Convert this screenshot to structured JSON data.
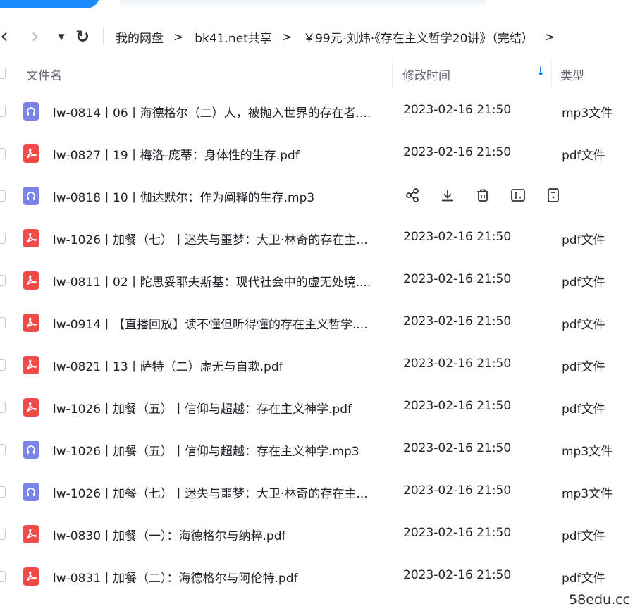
{
  "navigation": {
    "breadcrumb": [
      {
        "label": "我的网盘"
      },
      {
        "label": "bk41.net共享"
      },
      {
        "label": "￥99元-刘炜·《存在主义哲学20讲》（完结）"
      }
    ],
    "separator": ">",
    "tail": ">"
  },
  "table": {
    "columns": {
      "name": "文件名",
      "time": "修改时间",
      "type": "类型"
    },
    "sort": {
      "column": "time",
      "direction": "desc",
      "icon": "↓"
    },
    "rows": [
      {
        "icon": "mp3-audio-icon",
        "name": "lw-0814丨06丨海德格尔（二）人，被抛入世界的存在者....",
        "time": "2023-02-16 21:50",
        "type": "mp3文件"
      },
      {
        "icon": "pdf-icon",
        "name": "lw-0827丨19丨梅洛-庞蒂：身体性的生存.pdf",
        "time": "2023-02-16 21:50",
        "type": "pdf文件"
      },
      {
        "icon": "mp3-audio-icon",
        "name": "lw-0818丨10丨伽达默尔：作为阐释的生存.mp3",
        "hovered": true
      },
      {
        "icon": "pdf-icon",
        "name": "lw-1026丨加餐（七）丨迷失与噩梦：大卫·林奇的存在主...",
        "time": "2023-02-16 21:50",
        "type": "pdf文件"
      },
      {
        "icon": "pdf-icon",
        "name": "lw-0811丨02丨陀思妥耶夫斯基：现代社会中的虚无处境....",
        "time": "2023-02-16 21:50",
        "type": "pdf文件"
      },
      {
        "icon": "pdf-icon",
        "name": "lw-0914丨【直播回放】读不懂但听得懂的存在主义哲学....",
        "time": "2023-02-16 21:50",
        "type": "pdf文件"
      },
      {
        "icon": "pdf-icon",
        "name": "lw-0821丨13丨萨特（二）虚无与自欺.pdf",
        "time": "2023-02-16 21:50",
        "type": "pdf文件"
      },
      {
        "icon": "pdf-icon",
        "name": "lw-1026丨加餐（五）丨信仰与超越：存在主义神学.pdf",
        "time": "2023-02-16 21:50",
        "type": "pdf文件"
      },
      {
        "icon": "mp3-audio-icon",
        "name": "lw-1026丨加餐（五）丨信仰与超越：存在主义神学.mp3",
        "time": "2023-02-16 21:50",
        "type": "mp3文件"
      },
      {
        "icon": "mp3-audio-icon",
        "name": "lw-1026丨加餐（七）丨迷失与噩梦：大卫·林奇的存在主...",
        "time": "2023-02-16 21:50",
        "type": "mp3文件"
      },
      {
        "icon": "pdf-icon",
        "name": "lw-0830丨加餐（一）：海德格尔与纳粹.pdf",
        "time": "2023-02-16 21:50",
        "type": "pdf文件"
      },
      {
        "icon": "pdf-icon",
        "name": "lw-0831丨加餐（二）：海德格尔与阿伦特.pdf",
        "time": "2023-02-16 21:50",
        "type": "pdf文件"
      }
    ],
    "row_actions": [
      "share-icon",
      "download-icon",
      "delete-icon",
      "rename-icon",
      "more-icon"
    ]
  },
  "watermark": "58edu.cc",
  "colors": {
    "accent": "#1a8cff",
    "pdf": "#f04b4b",
    "mp3": "#7b84e8",
    "sort": "#1677ff"
  }
}
